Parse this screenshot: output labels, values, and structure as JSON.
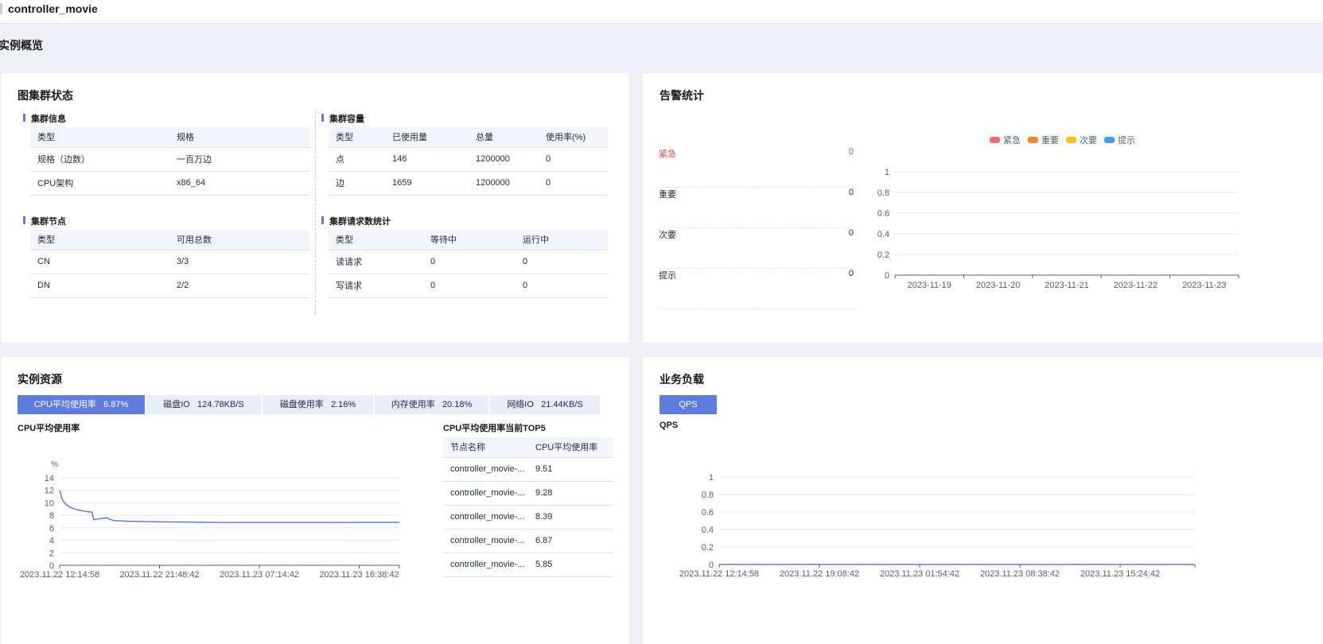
{
  "header": {
    "title": "controller_movie"
  },
  "page_title": "实例概览",
  "cluster_status": {
    "title": "图集群状态",
    "info": {
      "title": "集群信息",
      "columns": [
        "类型",
        "规格"
      ],
      "rows": [
        [
          "规格（边数）",
          "一百万边"
        ],
        [
          "CPU架构",
          "x86_64"
        ]
      ]
    },
    "nodes": {
      "title": "集群节点",
      "columns": [
        "类型",
        "可用总数"
      ],
      "rows": [
        [
          "CN",
          "3/3"
        ],
        [
          "DN",
          "2/2"
        ]
      ]
    },
    "capacity": {
      "title": "集群容量",
      "columns": [
        "类型",
        "已使用量",
        "总量",
        "使用率(%)"
      ],
      "rows": [
        [
          "点",
          "146",
          "1200000",
          "0"
        ],
        [
          "边",
          "1659",
          "1200000",
          "0"
        ]
      ]
    },
    "requests": {
      "title": "集群请求数统计",
      "columns": [
        "类型",
        "等待中",
        "运行中"
      ],
      "rows": [
        [
          "读请求",
          "0",
          "0"
        ],
        [
          "写请求",
          "0",
          "0"
        ]
      ]
    }
  },
  "alarm": {
    "title": "告警统计",
    "items": [
      {
        "label": "紧急",
        "count": "0",
        "color": "#e54545"
      },
      {
        "label": "重要",
        "count": "0",
        "color": "#252b3a"
      },
      {
        "label": "次要",
        "count": "0",
        "color": "#252b3a"
      },
      {
        "label": "提示",
        "count": "0",
        "color": "#252b3a"
      }
    ],
    "legend": [
      {
        "label": "紧急",
        "color": "#f66f6a"
      },
      {
        "label": "重要",
        "color": "#f5862b"
      },
      {
        "label": "次要",
        "color": "#fac20a"
      },
      {
        "label": "提示",
        "color": "#3ea0f4"
      }
    ]
  },
  "resources": {
    "title": "实例资源",
    "tabs": [
      {
        "label": "CPU平均使用率   6.87%",
        "active": true
      },
      {
        "label": "磁盘IO   124.78KB/S",
        "active": false
      },
      {
        "label": "磁盘使用率   2.16%",
        "active": false
      },
      {
        "label": "内存使用率   20.18%",
        "active": false
      },
      {
        "label": "网络IO   21.44KB/S",
        "active": false
      }
    ],
    "chart_title": "CPU平均使用率",
    "top5": {
      "title": "CPU平均使用率当前TOP5",
      "columns": [
        "节点名称",
        "CPU平均使用率"
      ],
      "rows": [
        [
          "controller_movie-...",
          "9.51"
        ],
        [
          "controller_movie-...",
          "9.28"
        ],
        [
          "controller_movie-...",
          "8.39"
        ],
        [
          "controller_movie-...",
          "6.87"
        ],
        [
          "controller_movie-...",
          "5.85"
        ]
      ]
    }
  },
  "workload": {
    "title": "业务负载",
    "button": "QPS",
    "chart_title": "QPS"
  },
  "chart_data": [
    {
      "type": "bar",
      "title": "",
      "categories": [
        "2023-11-19",
        "2023-11-20",
        "2023-11-21",
        "2023-11-22",
        "2023-11-23"
      ],
      "series": [
        {
          "name": "紧急",
          "values": [
            0,
            0,
            0,
            0,
            0
          ]
        },
        {
          "name": "重要",
          "values": [
            0,
            0,
            0,
            0,
            0
          ]
        },
        {
          "name": "次要",
          "values": [
            0,
            0,
            0,
            0,
            0
          ]
        },
        {
          "name": "提示",
          "values": [
            0,
            0,
            0,
            0,
            0
          ]
        }
      ],
      "ylim": [
        0,
        1
      ],
      "yticks": [
        "0",
        "0.2",
        "0.4",
        "0.6",
        "0.8",
        "1"
      ],
      "legend": "top",
      "grid": true
    },
    {
      "type": "line",
      "title": "CPU平均使用率",
      "ylabel": "%",
      "xticks": [
        "2023.11.22 12:14:58",
        "2023.11.22 21:48:42",
        "2023.11.23 07:14:42",
        "2023.11.23 16:38:42"
      ],
      "yticks": [
        "0",
        "2",
        "4",
        "6",
        "8",
        "10",
        "12",
        "14"
      ],
      "ylim": [
        0,
        14
      ],
      "color": "#5e7ce0",
      "x": [
        0,
        0.005,
        0.01,
        0.02,
        0.03,
        0.045,
        0.06,
        0.08,
        0.095,
        0.1,
        0.11,
        0.14,
        0.15,
        0.16,
        0.2,
        0.3,
        0.4,
        0.5,
        0.6,
        0.7,
        0.8,
        0.9,
        1.0
      ],
      "values": [
        12.0,
        11.0,
        10.3,
        9.7,
        9.3,
        9.0,
        8.8,
        8.6,
        8.5,
        7.3,
        7.4,
        7.6,
        7.3,
        7.15,
        7.05,
        6.95,
        6.9,
        6.85,
        6.85,
        6.85,
        6.85,
        6.87,
        6.87
      ]
    },
    {
      "type": "line",
      "title": "QPS",
      "xticks": [
        "2023.11.22 12:14:58",
        "2023.11.22 19:08:42",
        "2023.11.23 01:54:42",
        "2023.11.23 08:38:42",
        "2023.11.23 15:24:42"
      ],
      "yticks": [
        "0",
        "0.2",
        "0.4",
        "0.6",
        "0.8",
        "1"
      ],
      "ylim": [
        0,
        1
      ],
      "color": "#5e7ce0",
      "x": [
        0,
        1
      ],
      "values": [
        0,
        0
      ]
    }
  ]
}
